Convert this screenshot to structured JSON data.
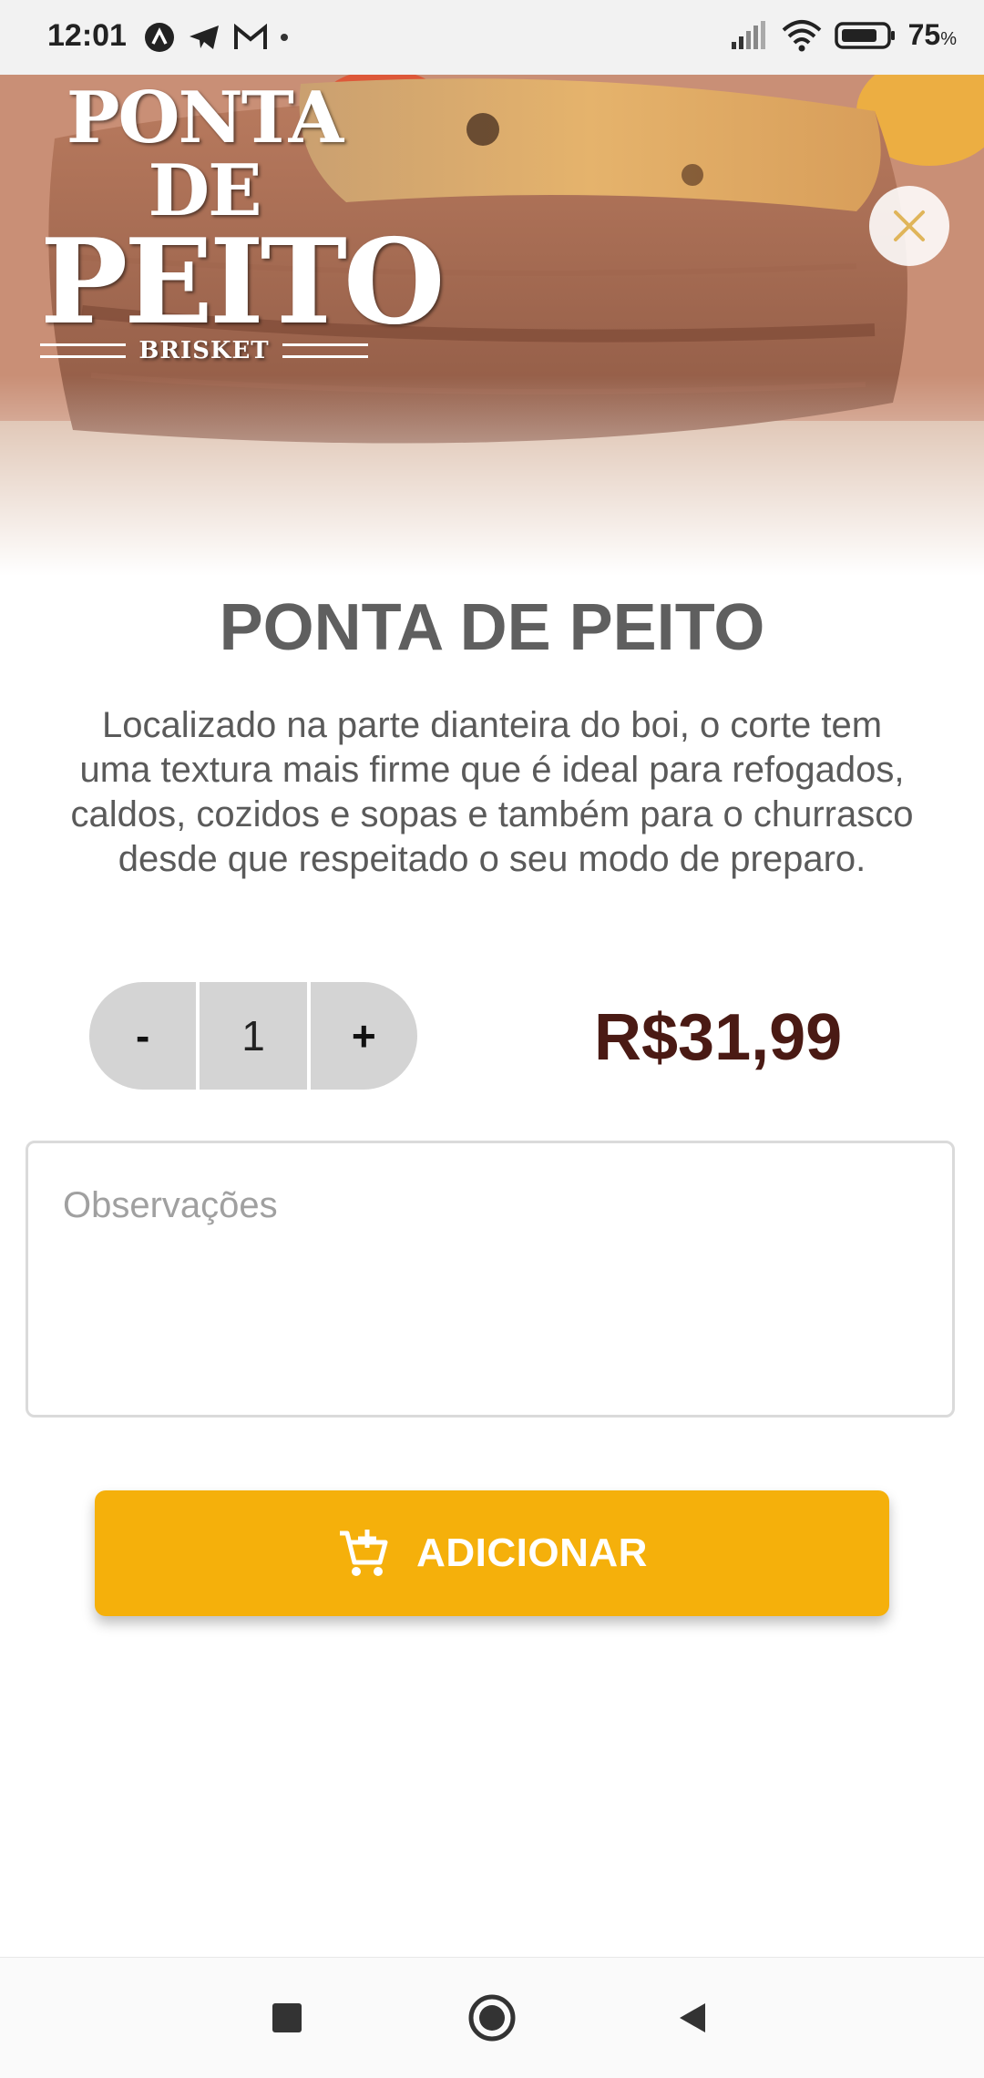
{
  "status_bar": {
    "time": "12:01",
    "battery_percent": "75",
    "battery_unit": "%",
    "icons": [
      "app-icon",
      "telegram-icon",
      "gmail-icon",
      "signal-icon",
      "wifi-icon",
      "battery-icon"
    ]
  },
  "hero": {
    "logo_line1": "PONTA DE",
    "logo_line2": "PEITO",
    "logo_sub": "BRISKET"
  },
  "product": {
    "title": "PONTA DE PEITO",
    "description": "Localizado na parte dianteira do boi, o corte tem uma textura mais firme que é ideal para refogados, caldos, cozidos e sopas e também para o churrasco desde que respeitado o seu modo de preparo.",
    "price": "R$31,99"
  },
  "stepper": {
    "minus": "-",
    "quantity": "1",
    "plus": "+"
  },
  "notes": {
    "placeholder": "Observações",
    "value": ""
  },
  "add_button": {
    "label": "ADICIONAR"
  },
  "colors": {
    "accent": "#f5b00b",
    "price": "#4a1a14",
    "title": "#5f5f5f",
    "close_icon": "#e0b55a"
  }
}
